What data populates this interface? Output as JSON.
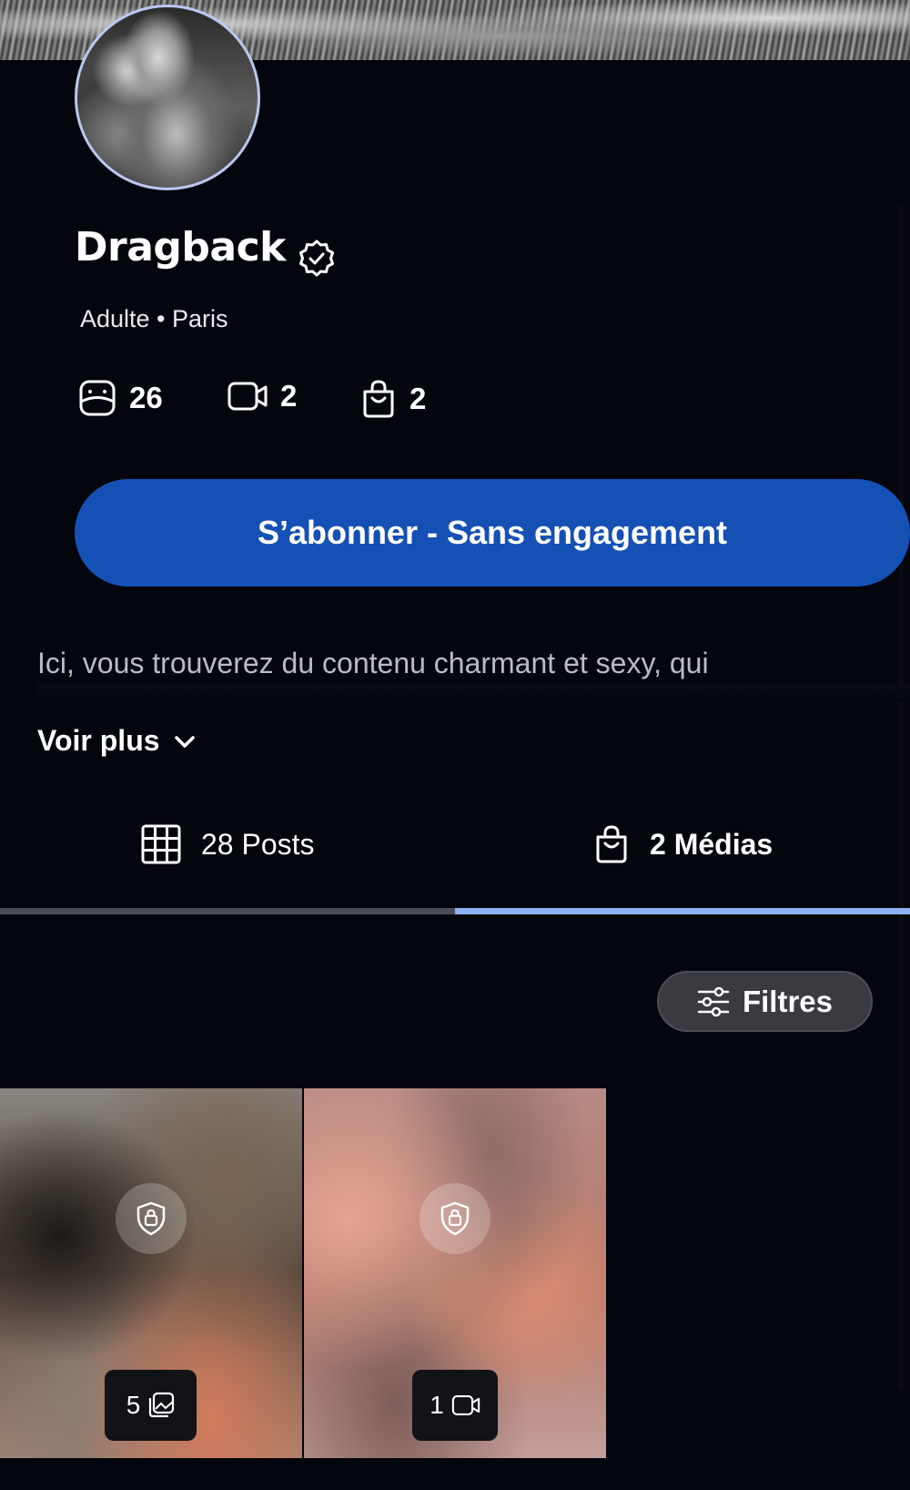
{
  "profile": {
    "name": "Dragback",
    "meta": "Adulte • Paris",
    "stats": [
      {
        "icon": "photo-icon",
        "value": "26"
      },
      {
        "icon": "video-icon",
        "value": "2"
      },
      {
        "icon": "shopping-bag-icon",
        "value": "2"
      }
    ]
  },
  "subscribe": {
    "label": "S’abonner - Sans engagement"
  },
  "bio": {
    "text": "Ici, vous trouverez du contenu charmant et sexy, qui",
    "see_more_label": "Voir plus"
  },
  "tabs": [
    {
      "icon": "grid-icon",
      "label": "28 Posts",
      "active": false
    },
    {
      "icon": "shopping-bag-icon",
      "label": "2 Médias",
      "active": true
    }
  ],
  "filters": {
    "label": "Filtres"
  },
  "media": [
    {
      "count": "5",
      "type_icon": "gallery-icon",
      "locked": true
    },
    {
      "count": "1",
      "type_icon": "video-icon",
      "locked": true
    }
  ],
  "colors": {
    "background": "#04060d",
    "accent_button": "#1550b4",
    "active_tab_indicator": "#8fb2f5"
  }
}
